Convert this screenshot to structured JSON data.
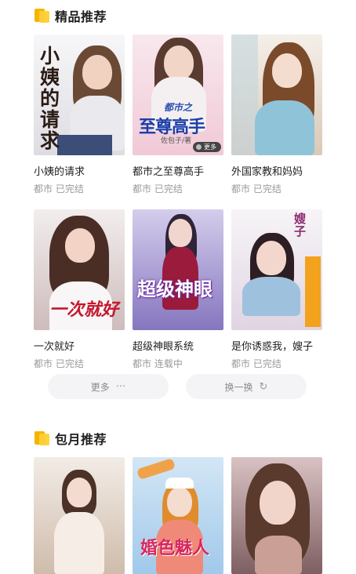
{
  "sections": {
    "featured": {
      "title": "精品推荐"
    },
    "monthly": {
      "title": "包月推荐"
    }
  },
  "featured_books": [
    {
      "title": "小姨的请求",
      "meta": "都市 已完结",
      "cover_text": "小姨的请求",
      "cover_colors": [
        "#f4f4f6",
        "#d7d7dc"
      ]
    },
    {
      "title": "都市之至尊高手",
      "meta": "都市 已完结",
      "cover_text": "至尊高手",
      "cover_colors": [
        "#f7e3ea",
        "#f1c8d6"
      ]
    },
    {
      "title": "外国家教和妈妈",
      "meta": "都市 已完结",
      "cover_text": "",
      "cover_colors": [
        "#f3ece6",
        "#d7c7b5"
      ]
    },
    {
      "title": "一次就好",
      "meta": "都市 已完结",
      "cover_text": "一次就好",
      "cover_colors": [
        "#efeaea",
        "#c7b8b8"
      ]
    },
    {
      "title": "超级神眼系统",
      "meta": "都市 连载中",
      "cover_text": "超级神眼",
      "cover_colors": [
        "#cfc7e8",
        "#8d7cc5"
      ]
    },
    {
      "title": "是你诱惑我，嫂子",
      "meta": "都市 已完结",
      "cover_text": "嫂子",
      "cover_colors": [
        "#f5f2f5",
        "#e3d7e6"
      ]
    }
  ],
  "cover_labels": {
    "book2_top": "都市之",
    "book2_author": "佐包子/著",
    "book2_badge": "更多"
  },
  "buttons": {
    "more_label": "更多",
    "more_icon": "···",
    "refresh_label": "换一换",
    "refresh_icon": "↻"
  },
  "monthly_books": [
    {
      "cover_text": "",
      "cover_colors": [
        "#efe9e3",
        "#cdb9a7"
      ]
    },
    {
      "cover_text": "婚色魅人",
      "cover_colors": [
        "#cfe3f4",
        "#9fc8ea"
      ]
    },
    {
      "cover_text": "",
      "cover_colors": [
        "#d9c3c4",
        "#8d6d6f"
      ]
    }
  ]
}
